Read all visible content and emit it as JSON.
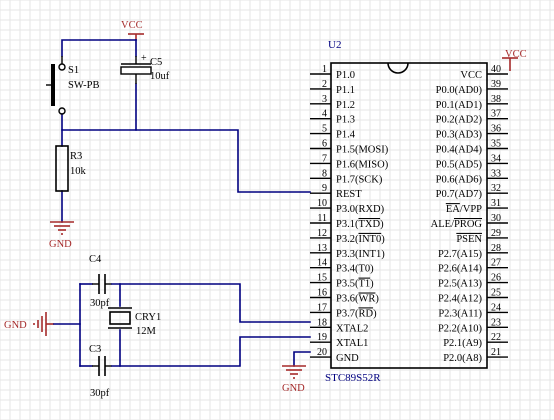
{
  "ic": {
    "ref": "U2",
    "part": "STC89S52R",
    "left_pins": [
      {
        "num": "1",
        "name": "P1.0"
      },
      {
        "num": "2",
        "name": "P1.1"
      },
      {
        "num": "3",
        "name": "P1.2"
      },
      {
        "num": "4",
        "name": "P1.3"
      },
      {
        "num": "5",
        "name": "P1.4"
      },
      {
        "num": "6",
        "name": "P1.5(MOSI)"
      },
      {
        "num": "7",
        "name": "P1.6(MISO)"
      },
      {
        "num": "8",
        "name": "P1.7(SCK)"
      },
      {
        "num": "9",
        "name": "REST"
      },
      {
        "num": "10",
        "name": "P3.0(RXD)"
      },
      {
        "num": "11",
        "name": "P3.1(TXD)"
      },
      {
        "num": "12",
        "name": "P3.2(INT0)"
      },
      {
        "num": "13",
        "name": "P3.3(INT1)"
      },
      {
        "num": "14",
        "name": "P3.4(T0)"
      },
      {
        "num": "15",
        "name": "P3.5(T1)"
      },
      {
        "num": "16",
        "name": "P3.6(WR)"
      },
      {
        "num": "17",
        "name": "P3.7(RD)"
      },
      {
        "num": "18",
        "name": "XTAL2"
      },
      {
        "num": "19",
        "name": "XTAL1"
      },
      {
        "num": "20",
        "name": "GND"
      }
    ],
    "right_pins": [
      {
        "num": "40",
        "name": "VCC"
      },
      {
        "num": "39",
        "name": "P0.0(AD0)"
      },
      {
        "num": "38",
        "name": "P0.1(AD1)"
      },
      {
        "num": "37",
        "name": "P0.2(AD2)"
      },
      {
        "num": "36",
        "name": "P0.3(AD3)"
      },
      {
        "num": "35",
        "name": "P0.4(AD4)"
      },
      {
        "num": "34",
        "name": "P0.5(AD5)"
      },
      {
        "num": "33",
        "name": "P0.6(AD6)"
      },
      {
        "num": "32",
        "name": "P0.7(AD7)"
      },
      {
        "num": "31",
        "name": "EA/VPP"
      },
      {
        "num": "30",
        "name": "ALE/PROG"
      },
      {
        "num": "29",
        "name": "PSEN"
      },
      {
        "num": "28",
        "name": "P2.7(A15)"
      },
      {
        "num": "27",
        "name": "P2.6(A14)"
      },
      {
        "num": "26",
        "name": "P2.5(A13)"
      },
      {
        "num": "25",
        "name": "P2.4(A12)"
      },
      {
        "num": "24",
        "name": "P2.3(A11)"
      },
      {
        "num": "23",
        "name": "P2.2(A10)"
      },
      {
        "num": "22",
        "name": "P2.1(A9)"
      },
      {
        "num": "21",
        "name": "P2.0(A8)"
      }
    ]
  },
  "components": {
    "switch": {
      "ref": "S1",
      "value": "SW-PB"
    },
    "c5": {
      "ref": "C5",
      "value": "10uf"
    },
    "r3": {
      "ref": "R3",
      "value": "10k"
    },
    "c4": {
      "ref": "C4",
      "value": "30pf"
    },
    "c3": {
      "ref": "C3",
      "value": "30pf"
    },
    "crystal": {
      "ref": "CRY1",
      "value": "12M"
    }
  },
  "power": {
    "vcc_top": "VCC",
    "vcc_right": "VCC",
    "gnd_reset": "GND",
    "gnd_left": "GND",
    "gnd_ic": "GND"
  }
}
